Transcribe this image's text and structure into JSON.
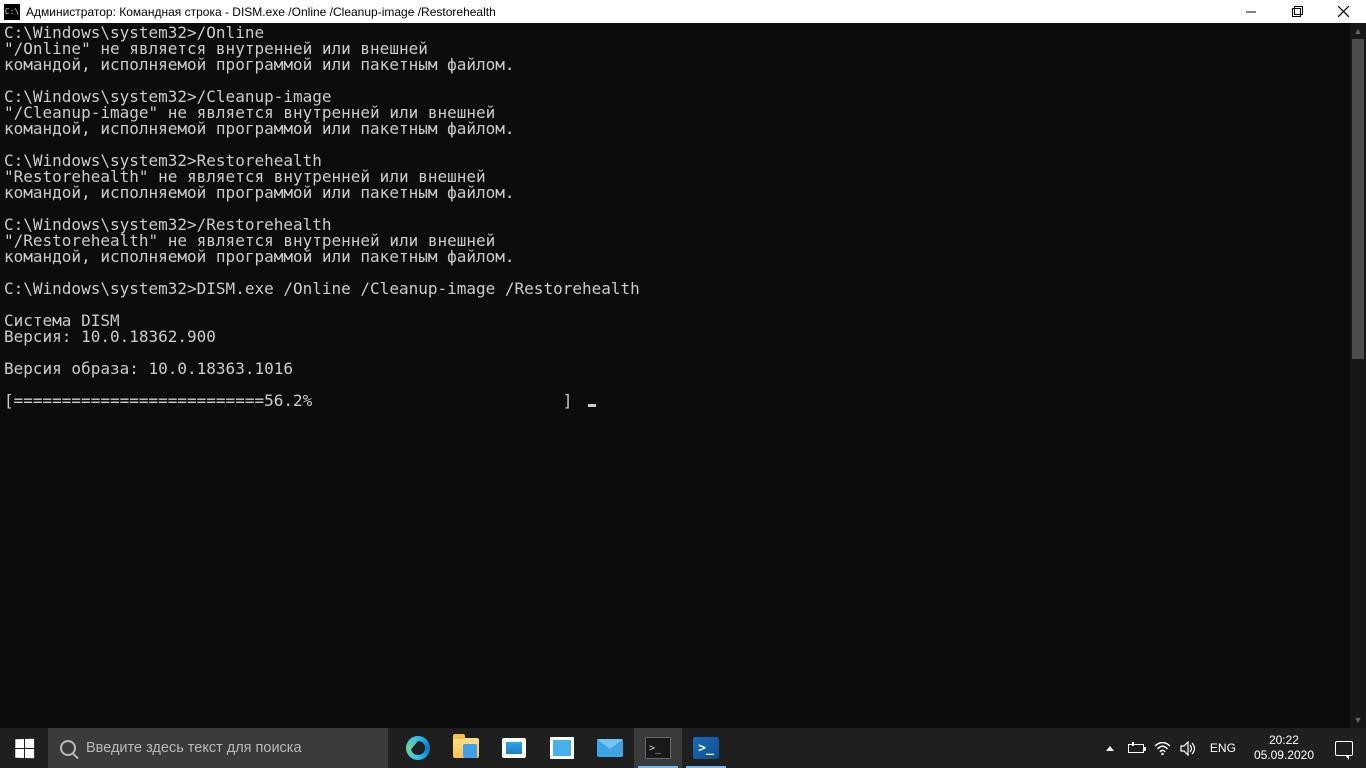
{
  "titlebar": {
    "icon_label": "C:\\",
    "title": "Администратор: Командная строка - DISM.exe  /Online /Cleanup-image /Restorehealth"
  },
  "console": {
    "lines": [
      "C:\\Windows\\system32>/Online",
      "\"/Online\" не является внутренней или внешней",
      "командой, исполняемой программой или пакетным файлом.",
      "",
      "C:\\Windows\\system32>/Cleanup-image",
      "\"/Cleanup-image\" не является внутренней или внешней",
      "командой, исполняемой программой или пакетным файлом.",
      "",
      "C:\\Windows\\system32>Restorehealth",
      "\"Restorehealth\" не является внутренней или внешней",
      "командой, исполняемой программой или пакетным файлом.",
      "",
      "C:\\Windows\\system32>/Restorehealth",
      "\"/Restorehealth\" не является внутренней или внешней",
      "командой, исполняемой программой или пакетным файлом.",
      "",
      "C:\\Windows\\system32>DISM.exe /Online /Cleanup-image /Restorehealth",
      "",
      "Cистема DISM",
      "Версия: 10.0.18362.900",
      "",
      "Версия образа: 10.0.18363.1016",
      ""
    ],
    "progress_line": "[==========================56.2%                          ] "
  },
  "taskbar": {
    "search_placeholder": "Введите здесь текст для поиска",
    "lang": "ENG",
    "time": "20:22",
    "date": "05.09.2020"
  }
}
